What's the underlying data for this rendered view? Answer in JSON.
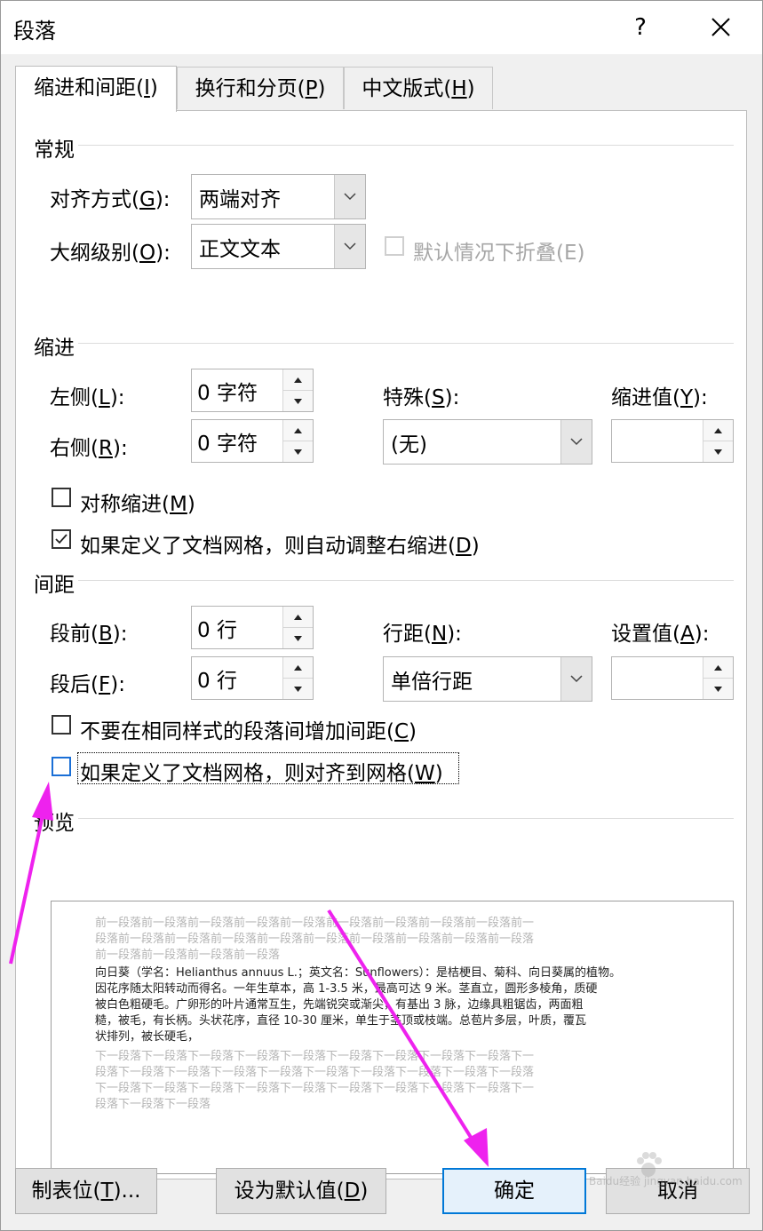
{
  "dialog": {
    "title": "段落",
    "help_label": "?"
  },
  "tabs": [
    {
      "label_pre": "缩进和间距(",
      "key": "I",
      "label_post": ")"
    },
    {
      "label_pre": "换行和分页(",
      "key": "P",
      "label_post": ")"
    },
    {
      "label_pre": "中文版式(",
      "key": "H",
      "label_post": ")"
    }
  ],
  "general": {
    "heading": "常规",
    "alignment": {
      "label_pre": "对齐方式(",
      "key": "G",
      "label_post": "):",
      "value": "两端对齐"
    },
    "outline": {
      "label_pre": "大纲级别(",
      "key": "O",
      "label_post": "):",
      "value": "正文文本"
    },
    "collapse_label": "默认情况下折叠(E)"
  },
  "indent": {
    "heading": "缩进",
    "left": {
      "label_pre": "左侧(",
      "key": "L",
      "label_post": "):",
      "value": "0 字符"
    },
    "right": {
      "label_pre": "右侧(",
      "key": "R",
      "label_post": "):",
      "value": "0 字符"
    },
    "special": {
      "label_pre": "特殊(",
      "key": "S",
      "label_post": "):",
      "value": "(无)"
    },
    "by": {
      "label_pre": "缩进值(",
      "key": "Y",
      "label_post": "):",
      "value": ""
    },
    "mirror": {
      "label_pre": "对称缩进(",
      "key": "M",
      "label_post": ")",
      "checked": false
    },
    "auto_adjust": {
      "label_pre": "如果定义了文档网格，则自动调整右缩进(",
      "key": "D",
      "label_post": ")",
      "checked": true
    }
  },
  "spacing": {
    "heading": "间距",
    "before": {
      "label_pre": "段前(",
      "key": "B",
      "label_post": "):",
      "value": "0 行"
    },
    "after": {
      "label_pre": "段后(",
      "key": "F",
      "label_post": "):",
      "value": "0 行"
    },
    "line": {
      "label_pre": "行距(",
      "key": "N",
      "label_post": "):",
      "value": "单倍行距"
    },
    "at": {
      "label_pre": "设置值(",
      "key": "A",
      "label_post": "):",
      "value": ""
    },
    "no_space": {
      "label_pre": "不要在相同样式的段落间增加间距(",
      "key": "C",
      "label_post": ")",
      "checked": false
    },
    "snap_grid": {
      "label_pre": "如果定义了文档网格，则对齐到网格(",
      "key": "W",
      "label_post": ")",
      "checked": false
    }
  },
  "preview": {
    "heading": "预览",
    "prev_lines": [
      "前一段落前一段落前一段落前一段落前一段落前一段落前一段落前一段落前一段落前一",
      "段落前一段落前一段落前一段落前一段落前一段落前一段落前一段落前一段落前一段落",
      "前一段落前一段落前一段落前一段落"
    ],
    "body_lines": [
      "向日葵（学名：Helianthus annuus L.；英文名：Sunflowers）：是桔梗目、菊科、向日葵属的植物。",
      "因花序随太阳转动而得名。一年生草本，高 1-3.5 米，最高可达 9 米。茎直立，圆形多棱角，质硬",
      "被白色粗硬毛。广卵形的叶片通常互生，先端锐突或渐尖，有基出 3 脉，边缘具粗锯齿，两面粗",
      "糙，被毛，有长柄。头状花序，直径 10-30 厘米，单生于茎顶或枝端。总苞片多层，叶质，覆瓦",
      "状排列，被长硬毛，"
    ],
    "next_lines": [
      "下一段落下一段落下一段落下一段落下一段落下一段落下一段落下一段落下一段落下一",
      "段落下一段落下一段落下一段落下一段落下一段落下一段落下一段落下一段落下一段落",
      "下一段落下一段落下一段落下一段落下一段落下一段落下一段落下一段落下一段落下一",
      "段落下一段落下一段落"
    ]
  },
  "buttons": {
    "tabs": {
      "label_pre": "制表位(",
      "key": "T",
      "label_post": ")..."
    },
    "default": {
      "label_pre": "设为默认值(",
      "key": "D",
      "label_post": ")"
    },
    "ok": "确定",
    "cancel": "取消"
  },
  "watermark": "Baidu经验 jingyan.baidu.com",
  "colors": {
    "annotation_arrow": "#ee22ee",
    "focus_blue": "#0078d7"
  }
}
